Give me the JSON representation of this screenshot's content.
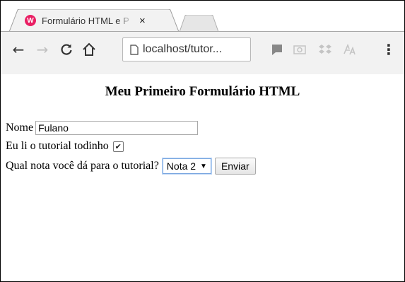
{
  "browser": {
    "tab": {
      "favicon_letter": "W",
      "title": "Formulário HTML e P",
      "close": "×"
    },
    "toolbar": {
      "back": "←",
      "forward": "→",
      "reload": "C",
      "home": "⌂",
      "address": "localhost/tutor...",
      "menu": "⋮"
    }
  },
  "page": {
    "title": "Meu Primeiro Formulário HTML",
    "form": {
      "name_label": "Nome",
      "name_value": "Fulano",
      "read_label": "Eu li o tutorial todinho",
      "read_checked": "✔",
      "rating_label": "Qual nota você dá para o tutorial?",
      "rating_selected": "Nota 2",
      "rating_caret": "▼",
      "submit_label": "Enviar"
    }
  },
  "colors": {
    "favicon": "#e91e63",
    "chrome_bg": "#f2f2f2",
    "select_focus": "#7aa7e0"
  },
  "icons": [
    "tab-favicon-icon",
    "close-icon",
    "back-arrow-icon",
    "forward-arrow-icon",
    "reload-icon",
    "home-icon",
    "page-icon",
    "extension-pushbullet-icon",
    "extension-camera-icon",
    "extension-dropbox-icon",
    "extension-translate-icon",
    "menu-icon"
  ]
}
